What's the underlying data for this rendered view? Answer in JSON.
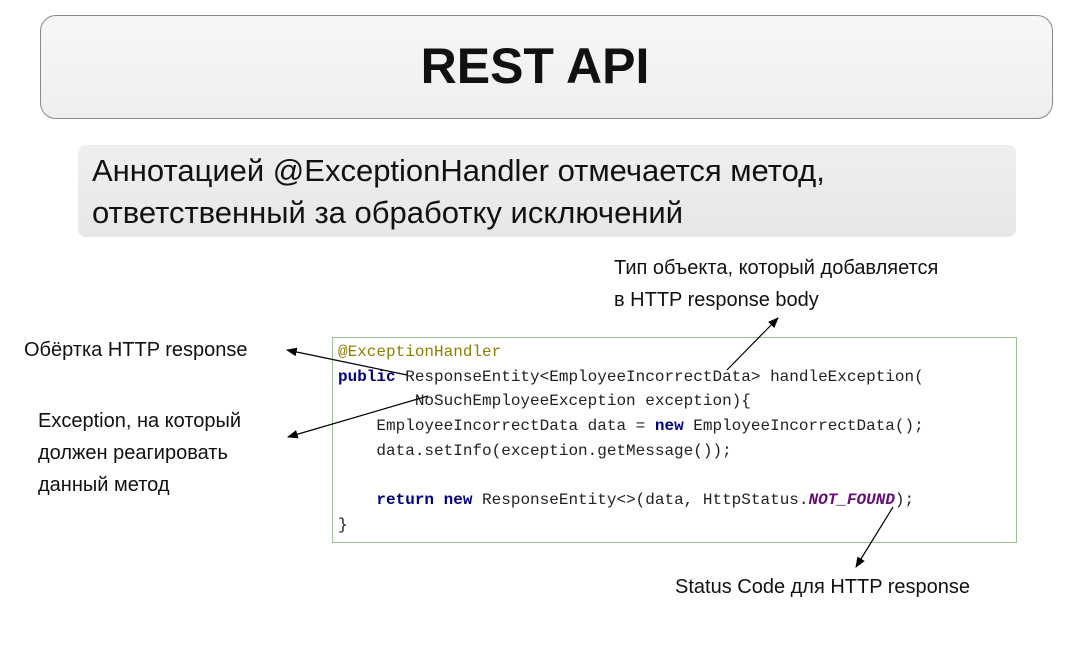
{
  "slide": {
    "title": "REST API",
    "subtitle": {
      "line1": "Аннотацией @ExceptionHandler отмечается метод,",
      "line2": "ответственный за обработку исключений"
    }
  },
  "annotations": {
    "response_body": {
      "line1": "Тип объекта, который добавляется",
      "line2": "в HTTP response body"
    },
    "wrapper": "Обёртка HTTP response",
    "exception": {
      "line1": "Exception, на который",
      "line2": "должен реагировать",
      "line3": "данный метод"
    },
    "status": "Status Code для HTTP response"
  },
  "code": {
    "l1": "@ExceptionHandler",
    "l2_kw": "public",
    "l2_rest": " ResponseEntity<EmployeeIncorrectData> handleException(",
    "l3": "        NoSuchEmployeeException exception){",
    "l4_a": "    EmployeeIncorrectData data = ",
    "l4_kw": "new",
    "l4_b": " EmployeeIncorrectData();",
    "l5": "    data.setInfo(exception.getMessage());",
    "l6": "",
    "l7_indent": "    ",
    "l7_kw1": "return",
    "l7_sp": " ",
    "l7_kw2": "new",
    "l7_a": " ResponseEntity<>(data, HttpStatus.",
    "l7_const": "NOT_FOUND",
    "l7_b": ");",
    "l8": "}"
  },
  "colors": {
    "code_border": "#9bc48c",
    "annotation": "#8b8000",
    "keyword": "#000080",
    "constant": "#660e7a"
  }
}
